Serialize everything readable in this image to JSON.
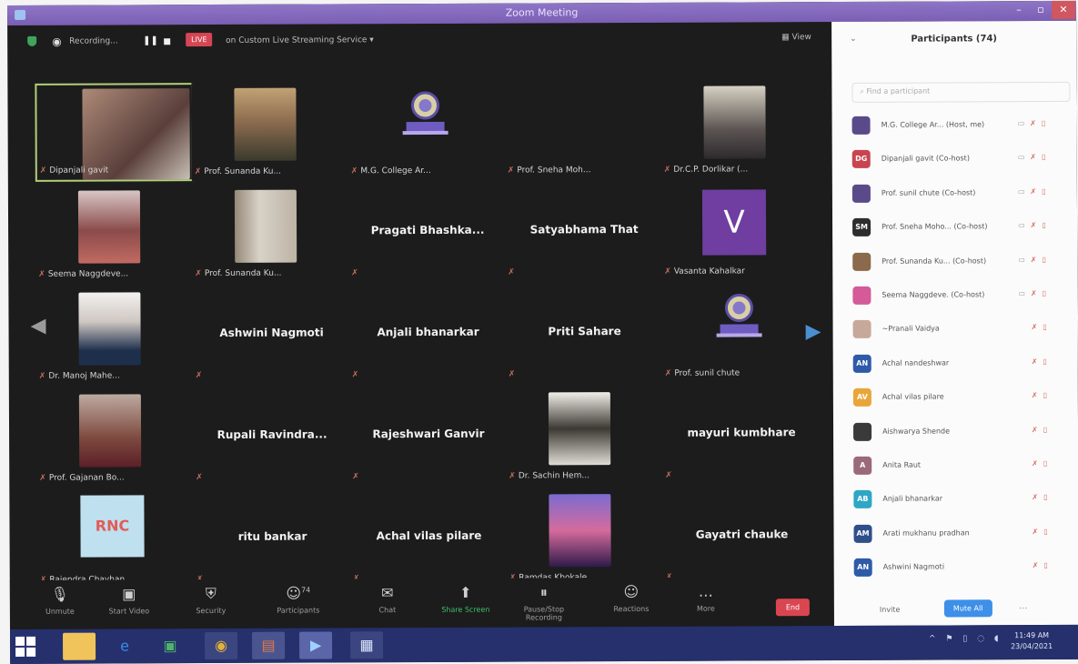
{
  "window": {
    "title": "Zoom Meeting"
  },
  "topbar": {
    "recording": "Recording...",
    "live": "LIVE",
    "stream": "on Custom Live Streaming Service ▾",
    "view": "▦ View"
  },
  "tiles": [
    {
      "name": "Dipanjali gavit",
      "kind": "video",
      "v": "v1",
      "active": true
    },
    {
      "name": "Prof. Sunanda Ku...",
      "kind": "video",
      "v": "v2"
    },
    {
      "name": "M.G. College Ar...",
      "kind": "logo"
    },
    {
      "name": "Prof. Sneha Moh...",
      "kind": "blank"
    },
    {
      "name": "Dr.C.P. Dorlikar (...",
      "kind": "video",
      "v": "v3"
    },
    {
      "name": "Seema Naggdeve...",
      "kind": "video",
      "v": "v4"
    },
    {
      "name": "Prof. Sunanda Ku...",
      "kind": "video",
      "v": "v5"
    },
    {
      "name": "",
      "big": "Pragati  Bhashka...",
      "kind": "text"
    },
    {
      "name": "",
      "big": "Satyabhama That",
      "kind": "text"
    },
    {
      "name": "Vasanta Kahalkar",
      "kind": "avatar",
      "letter": "V"
    },
    {
      "name": "Dr. Manoj Mahe...",
      "kind": "video",
      "v": "v6"
    },
    {
      "name": "",
      "big": "Ashwini Nagmoti",
      "kind": "text"
    },
    {
      "name": "",
      "big": "Anjali bhanarkar",
      "kind": "text"
    },
    {
      "name": "",
      "big": "Priti Sahare",
      "kind": "text"
    },
    {
      "name": "Prof. sunil chute",
      "kind": "logo"
    },
    {
      "name": "Prof. Gajanan Bo...",
      "kind": "video",
      "v": "v7"
    },
    {
      "name": "",
      "big": "Rupali  Ravindra...",
      "kind": "text"
    },
    {
      "name": "",
      "big": "Rajeshwari Ganvir",
      "kind": "text"
    },
    {
      "name": "Dr. Sachin Hem...",
      "kind": "video",
      "v": "v8"
    },
    {
      "name": "",
      "big": "mayuri kumbhare",
      "kind": "text"
    },
    {
      "name": "Rajendra Chavhan",
      "kind": "rnc",
      "rnc": "RNC"
    },
    {
      "name": "",
      "big": "ritu bankar",
      "kind": "text"
    },
    {
      "name": "",
      "big": "Achal vilas pilare",
      "kind": "text"
    },
    {
      "name": "Ramdas Khokale",
      "kind": "video",
      "v": "v9"
    },
    {
      "name": "",
      "big": "Gayatri  chauke",
      "kind": "text"
    }
  ],
  "toolbar": {
    "items": [
      {
        "label": "Unmute",
        "icon": "🎙"
      },
      {
        "label": "Start Video",
        "icon": "▣"
      },
      {
        "label": "Security",
        "icon": "⛨"
      },
      {
        "label": "Participants",
        "icon": "☺",
        "badge": "74"
      },
      {
        "label": "Chat",
        "icon": "✉"
      },
      {
        "label": "Share Screen",
        "icon": "⬆"
      },
      {
        "label": "Pause/Stop Recording",
        "icon": "⏸"
      },
      {
        "label": "Reactions",
        "icon": "☺"
      },
      {
        "label": "More",
        "icon": "…"
      }
    ],
    "end": "End"
  },
  "panel": {
    "title": "Participants (74)",
    "search_placeholder": "Find a participant",
    "invite": "Invite",
    "mute_all": "Mute All",
    "more": "...",
    "participants": [
      {
        "name": "M.G. College Ar...  (Host, me)",
        "initials": "",
        "color": "#5b4a8a"
      },
      {
        "name": "Dipanjali gavit (Co-host)",
        "initials": "DG",
        "color": "#c8454f"
      },
      {
        "name": "Prof. sunil chute (Co-host)",
        "initials": "",
        "color": "#5b4a8a"
      },
      {
        "name": "Prof. Sneha Moho... (Co-host)",
        "initials": "SM",
        "color": "#2d2d2d"
      },
      {
        "name": "Prof. Sunanda Ku... (Co-host)",
        "initials": "",
        "color": "#8a6a4a"
      },
      {
        "name": "Seema Naggdeve. (Co-host)",
        "initials": "",
        "color": "#d45a9a"
      },
      {
        "name": "~Pranali Vaidya",
        "initials": "",
        "color": "#c7a89a"
      },
      {
        "name": "Achal nandeshwar",
        "initials": "AN",
        "color": "#2e5aa8"
      },
      {
        "name": "Achal vilas pilare",
        "initials": "AV",
        "color": "#e8a63a"
      },
      {
        "name": "Aishwarya Shende",
        "initials": "",
        "color": "#3a3a3a"
      },
      {
        "name": "Anita Raut",
        "initials": "A",
        "color": "#9a6a7a"
      },
      {
        "name": "Anjali bhanarkar",
        "initials": "AB",
        "color": "#2fa6c4"
      },
      {
        "name": "Arati mukhanu pradhan",
        "initials": "AM",
        "color": "#2e4f8a"
      },
      {
        "name": "Ashwini Nagmoti",
        "initials": "AN",
        "color": "#2e5aa8"
      }
    ]
  },
  "clock": {
    "time": "11:49 AM",
    "date": "23/04/2021"
  }
}
